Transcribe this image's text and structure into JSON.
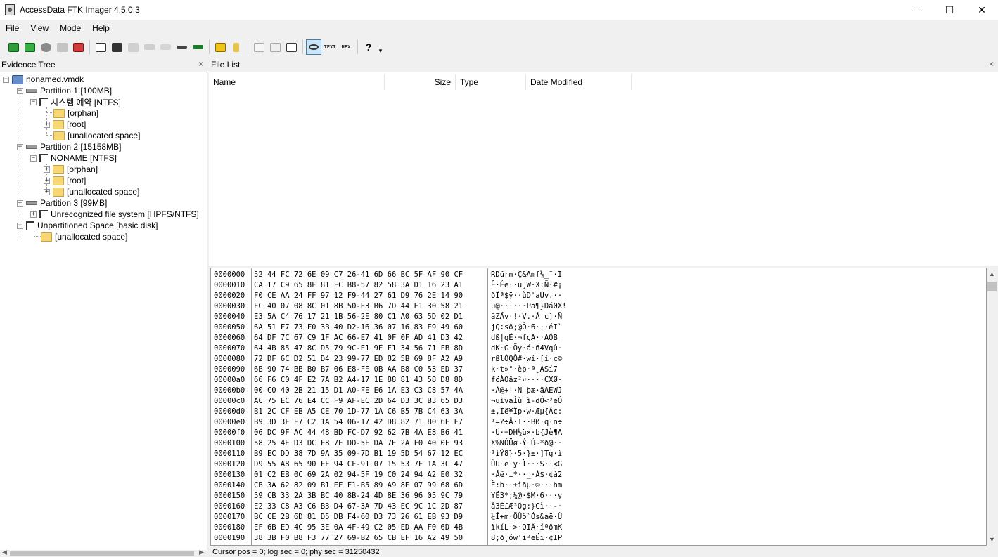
{
  "window": {
    "title": "AccessData FTK Imager 4.5.0.3",
    "minimize": "—",
    "maximize": "☐",
    "close": "✕"
  },
  "menu": [
    "File",
    "View",
    "Mode",
    "Help"
  ],
  "toolbar": {
    "text_label": "TEXT",
    "hex_label": "HEX",
    "help_label": "?",
    "dropdown_label": "▾"
  },
  "evidence_tree": {
    "title": "Evidence Tree",
    "close": "×",
    "nodes": [
      "nonamed.vmdk",
      "Partition 1 [100MB]",
      "시스템 예약 [NTFS]",
      "[orphan]",
      "[root]",
      "[unallocated space]",
      "Partition 2 [15158MB]",
      "NONAME [NTFS]",
      "[orphan]",
      "[root]",
      "[unallocated space]",
      "Partition 3 [99MB]",
      "Unrecognized file system [HPFS/NTFS]",
      "Unpartitioned Space [basic disk]",
      "[unallocated space]"
    ],
    "expand": "+",
    "collapse": "−"
  },
  "file_list": {
    "title": "File List",
    "close": "×",
    "columns": [
      "Name",
      "Size",
      "Type",
      "Date Modified"
    ]
  },
  "hex": {
    "rows": [
      [
        "0000000",
        "52 44 FC 72 6E 09 C7 26-41 6D 66 BC 5F AF 90 CF",
        "RDürn·Ç&Amf¼_¯·Ï"
      ],
      [
        "0000010",
        "CA 17 C9 65 8F 81 FC B8-57 82 58 3A D1 16 23 A1",
        "Ê·Ée··ü¸W·X:Ñ·#¡"
      ],
      [
        "0000020",
        "F0 CE AA 24 FF 97 12 F9-44 27 61 D9 76 2E 14 90",
        "ðÎª$ÿ··ùD'aÙv.··"
      ],
      [
        "0000030",
        "FC 40 07 08 8C 01 8B 50-E3 B6 7D 44 E1 30 58 21",
        "ü@······Pã¶}Dá0X!"
      ],
      [
        "0000040",
        "E3 5A C4 76 17 21 1B 56-2E 80 C1 A0 63 5D 02 D1",
        "ãZÄv·!·V.·Á c]·Ñ"
      ],
      [
        "0000050",
        "6A 51 F7 73 F0 3B 40 D2-16 36 07 16 83 E9 49 60",
        "jQ÷sð;@Ò·6···éI`"
      ],
      [
        "0000060",
        "64 DF 7C 67 C9 1F AC 66-E7 41 0F 0F AD 41 D3 42",
        "dß|gÉ·¬fçA··­AÓB"
      ],
      [
        "0000070",
        "64 4B 85 47 8C D5 79 9C-E1 9E F1 34 56 71 FB 8D",
        "dK·G·Õy·á·ñ4Vqû·"
      ],
      [
        "0000080",
        "72 DF 6C D2 51 D4 23 99-77 ED 82 5B 69 8F A2 A9",
        "rßlÒQÔ#·wí·[i·¢©"
      ],
      [
        "0000090",
        "6B 90 74 BB B0 B7 06 E8-FE 0B AA B8 C0 53 ED 37",
        "k·t»°·èþ·ª¸ÀSí7"
      ],
      [
        "00000a0",
        "66 F6 C0 4F E2 7A B2 A4-17 1E 88 81 43 58 D8 8D",
        "föÀOâz²¤····CXØ·"
      ],
      [
        "00000b0",
        "00 C0 40 2B 21 15 D1 A0-FE E6 1A E3 C3 C8 57 4A",
        "·À@+!·Ñ þæ·ãÃÈWJ"
      ],
      [
        "00000c0",
        "AC 75 EC 76 E4 CC F9 AF-EC 2D 64 D3 3C B3 65 D3",
        "¬uìväÌù¯ì-dÓ<³eÓ"
      ],
      [
        "00000d0",
        "B1 2C CF EB A5 CE 70 1D-77 1A C6 B5 7B C4 63 3A",
        "±,Ïë¥Îp·w·Æµ{Äc:"
      ],
      [
        "00000e0",
        "B9 3D 3F F7 C2 1A 54 06-17 42 D8 82 71 80 6E F7",
        "¹=?÷Â·T··BØ·q·n÷"
      ],
      [
        "00000f0",
        "06 DC 9F AC 44 48 BD FC-D7 92 62 7B 4A E8 B6 41",
        "·Ü·¬DH½ü×·b{Jè¶A"
      ],
      [
        "0000100",
        "58 25 4E D3 DC F8 7E DD-5F DA 7E 2A F0 40 0F 93",
        "X%NÓÜø~Ý_Ú~*ð@··"
      ],
      [
        "0000110",
        "B9 EC DD 38 7D 9A 35 09-7D B1 19 5D 54 67 12 EC",
        "¹ìÝ8}·5·}±·]Tg·ì"
      ],
      [
        "0000120",
        "D9 55 A8 65 90 FF 94 CF-91 07 15 53 7F 1A 3C 47",
        "ÙU¨e·ÿ·Ï···S··<G"
      ],
      [
        "0000130",
        "01 C2 EB 0C 69 2A 02 94-5F 19 C0 24 94 A2 E0 32",
        "·Âë·i*··_·À$·¢à2"
      ],
      [
        "0000140",
        "CB 3A 62 82 09 B1 EE F1-B5 89 A9 8E 07 99 68 6D",
        "Ë:b··±îñµ·©···hm"
      ],
      [
        "0000150",
        "59 CB 33 2A 3B BC 40 8B-24 4D 8E 36 96 05 9C 79",
        "YË3*;¼@·$M·6···y"
      ],
      [
        "0000160",
        "E2 33 C8 A3 C6 B3 D4 67-3A 7D 43 EC 9C 1C 2D 87",
        "â3È£Æ³Ôg:}Cì··-·"
      ],
      [
        "0000170",
        "BC CE 2B 6D 81 D5 DB F4-60 D3 73 26 61 EB 93 D9",
        "¼Î+m·ÕÛô`Ós&aë·Ù"
      ],
      [
        "0000180",
        "EF 6B ED 4C 95 3E 0A 4F-49 C2 05 ED AA F0 6D 4B",
        "ïkíL·>·OIÂ·íªðmK"
      ],
      [
        "0000190",
        "38 3B F0 B8 F3 77 27 69-B2 65 CB EF 16 A2 49 50",
        "8;ð¸ów'i²eËï·¢IP"
      ]
    ]
  },
  "status": "Cursor pos = 0; log sec = 0; phy sec = 31250432",
  "colors": {
    "folder": "#f7d774",
    "accent": "#3c7fb1"
  }
}
